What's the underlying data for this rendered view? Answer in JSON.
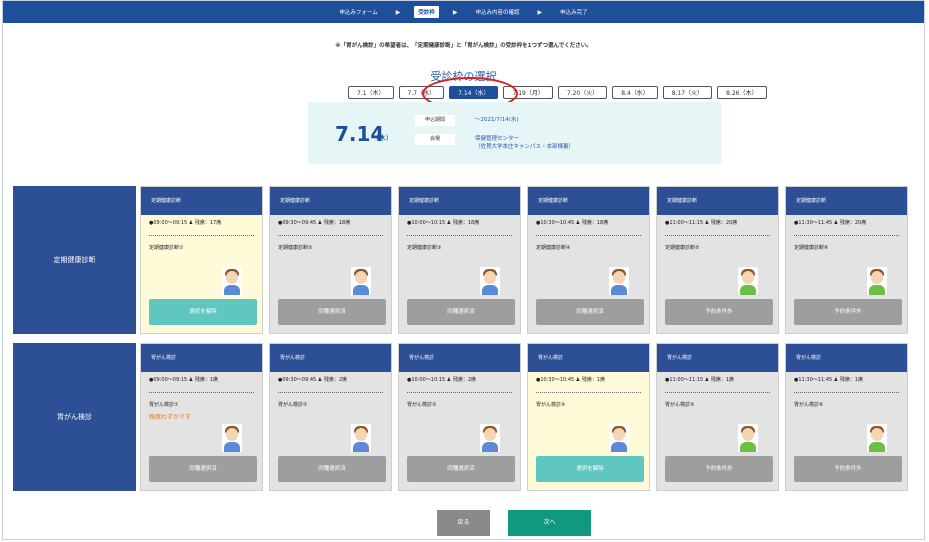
{
  "steps": [
    "申込みフォーム",
    "受診枠",
    "申込み内容の確認",
    "申込み完了"
  ],
  "notice": "※「胃がん検診」の希望者は、「定期健康診断」と「胃がん検診」の受診枠を1つずつ選んでください。",
  "selection_title": "受診枠の選択",
  "dates": [
    "7.1（木）",
    "7.7（水）",
    "7.14（水）",
    "7.19（月）",
    "7.20（火）",
    "8.4（水）",
    "8.17（火）",
    "8.26（木）"
  ],
  "selected_date_index": 2,
  "info": {
    "big_date": "7.14",
    "big_day": "(水)",
    "deadline_label": "申込期間",
    "deadline_value": "～2021/7/14(水)",
    "venue_label": "会場",
    "venue_line1": "保健管理センター",
    "venue_line2": "（佐賀大学本庄キャンパス・本部棟裏）"
  },
  "rows": [
    {
      "label": "定期健康診断",
      "cards": [
        {
          "title": "定期健康診断",
          "time": "09:00～09:15",
          "remain": "残席：17席",
          "name": "定期健康診断①",
          "warn": "",
          "button": "選択を解除",
          "selected": true,
          "avatar": "man-blue"
        },
        {
          "title": "定期健康診断",
          "time": "09:30～09:45",
          "remain": "残席：18席",
          "name": "定期健康診断②",
          "warn": "",
          "button": "同種選択済",
          "selected": false,
          "avatar": "man-blue"
        },
        {
          "title": "定期健康診断",
          "time": "10:00～10:15",
          "remain": "残席：18席",
          "name": "定期健康診断③",
          "warn": "",
          "button": "同種選択済",
          "selected": false,
          "avatar": "man-blue"
        },
        {
          "title": "定期健康診断",
          "time": "10:30～10:45",
          "remain": "残席：18席",
          "name": "定期健康診断④",
          "warn": "",
          "button": "同種選択済",
          "selected": false,
          "avatar": "man-blue"
        },
        {
          "title": "定期健康診断",
          "time": "11:00～11:15",
          "remain": "残席：20席",
          "name": "定期健康診断⑤",
          "warn": "",
          "button": "予約条件外",
          "selected": false,
          "avatar": "woman-green"
        },
        {
          "title": "定期健康診断",
          "time": "11:30～11:45",
          "remain": "残席：20席",
          "name": "定期健康診断⑥",
          "warn": "",
          "button": "予約条件外",
          "selected": false,
          "avatar": "woman-green"
        }
      ]
    },
    {
      "label": "胃がん検診",
      "cards": [
        {
          "title": "胃がん検診",
          "time": "09:00～09:15",
          "remain": "残席：1席",
          "name": "胃がん検診①",
          "warn": "残席わずかです",
          "button": "同種選択済",
          "selected": false,
          "avatar": "man-blue"
        },
        {
          "title": "胃がん検診",
          "time": "09:30～09:45",
          "remain": "残席：2席",
          "name": "胃がん検診②",
          "warn": "",
          "button": "同種選択済",
          "selected": false,
          "avatar": "man-blue"
        },
        {
          "title": "胃がん検診",
          "time": "10:00～10:15",
          "remain": "残席：2席",
          "name": "胃がん検診③",
          "warn": "",
          "button": "同種選択済",
          "selected": false,
          "avatar": "man-blue"
        },
        {
          "title": "胃がん検診",
          "time": "10:30～10:45",
          "remain": "残席：1席",
          "name": "胃がん検診④",
          "warn": "",
          "button": "選択を解除",
          "selected": true,
          "avatar": "man-blue"
        },
        {
          "title": "胃がん検診",
          "time": "11:00～11:15",
          "remain": "残席：1席",
          "name": "胃がん検診⑤",
          "warn": "",
          "button": "予約条件外",
          "selected": false,
          "avatar": "woman-green"
        },
        {
          "title": "胃がん検診",
          "time": "11:30～11:45",
          "remain": "残席：1席",
          "name": "胃がん検診⑥",
          "warn": "",
          "button": "予約条件外",
          "selected": false,
          "avatar": "woman-green"
        }
      ]
    }
  ],
  "buttons": {
    "back": "戻る",
    "next": "次へ"
  },
  "colors": {
    "header_blue": "#1d4f9b",
    "row_label": "#2d4f96",
    "release_btn": "#5fc6c0",
    "next_btn": "#0f9a80",
    "warning": "#e07a10",
    "highlight": "#d92020"
  }
}
